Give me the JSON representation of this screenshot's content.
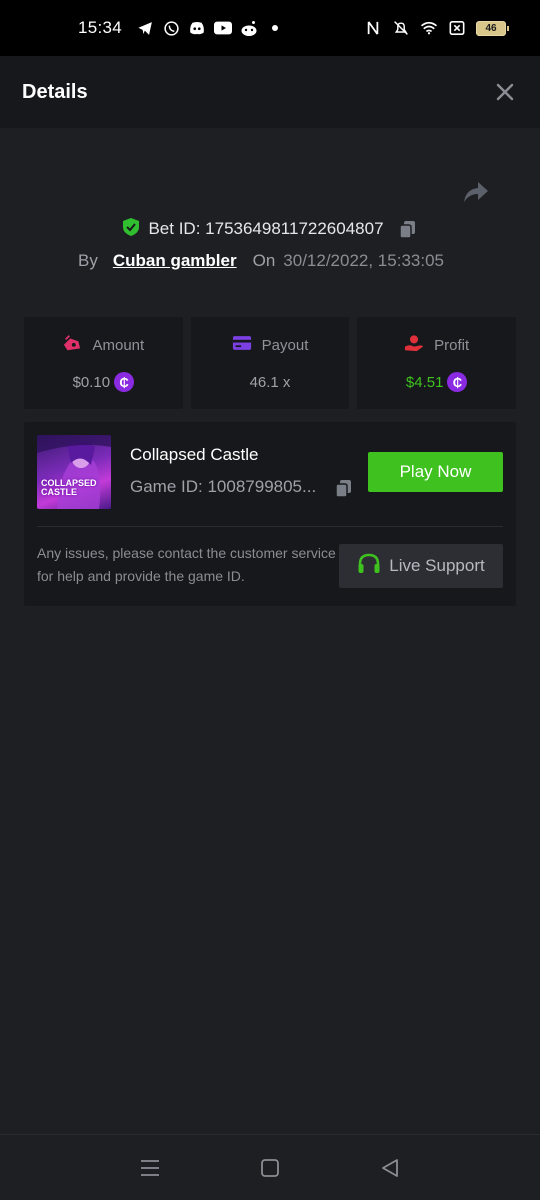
{
  "status_bar": {
    "time": "15:34",
    "battery": "46",
    "left_icons": [
      "telegram-icon",
      "whatsapp-icon",
      "discord-icon",
      "youtube-icon",
      "reddit-icon",
      "dot-icon"
    ],
    "right_icons": [
      "nfc-icon",
      "bell-off-icon",
      "wifi-icon",
      "sim-x-icon",
      "battery-icon"
    ]
  },
  "header": {
    "title": "Details",
    "close_icon": "close-icon"
  },
  "bet": {
    "id_text": "Bet ID: 1753649811722604807",
    "by_label": "By",
    "user": "Cuban gambler",
    "on_label": "On",
    "date": "30/12/2022, 15:33:05"
  },
  "stats": {
    "amount": {
      "label": "Amount",
      "value": "$0.10",
      "icon": "amount-icon"
    },
    "payout": {
      "label": "Payout",
      "value": "46.1 x",
      "icon": "card-icon"
    },
    "profit": {
      "label": "Profit",
      "value": "$4.51",
      "icon": "profit-icon"
    },
    "coin_symbol": "₵"
  },
  "game": {
    "title": "Collapsed Castle",
    "game_id": "Game ID: 1008799805...",
    "thumbnail_text": "COLLAPSED CASTLE",
    "play_label": "Play Now",
    "support_text": "Any issues, please contact the customer service for help and provide the game ID.",
    "live_support_label": "Live Support"
  },
  "colors": {
    "accent_green": "#3fc21f",
    "coin_purple": "#8a2be2",
    "shield_green": "#2fbf2f",
    "amount_pink": "#e0306a",
    "card_purple": "#7b3fe4",
    "profit_red": "#e0303a"
  },
  "nav": {
    "icons": [
      "menu-icon",
      "home-icon",
      "back-icon"
    ]
  }
}
